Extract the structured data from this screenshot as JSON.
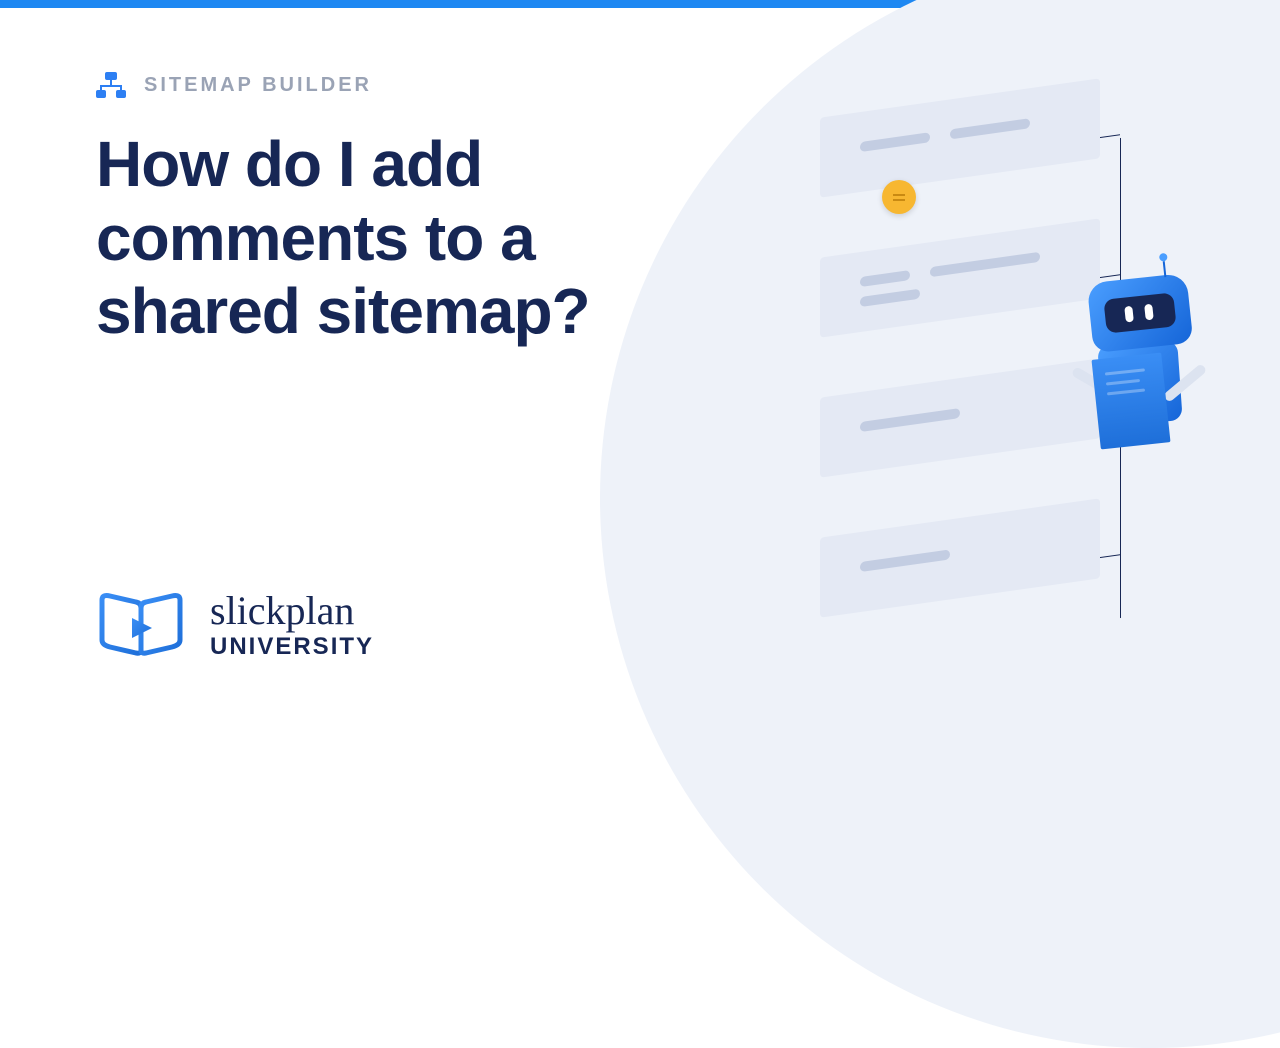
{
  "eyebrow": "SITEMAP BUILDER",
  "title": "How do I add comments to a shared sitemap?",
  "brand": {
    "script": "slickplan",
    "sub": "UNIVERSITY"
  },
  "colors": {
    "accent": "#1e88f2",
    "heading": "#172755",
    "muted": "#9aa3b5",
    "bgshape": "#eef2f9",
    "pin": "#f7b731"
  }
}
